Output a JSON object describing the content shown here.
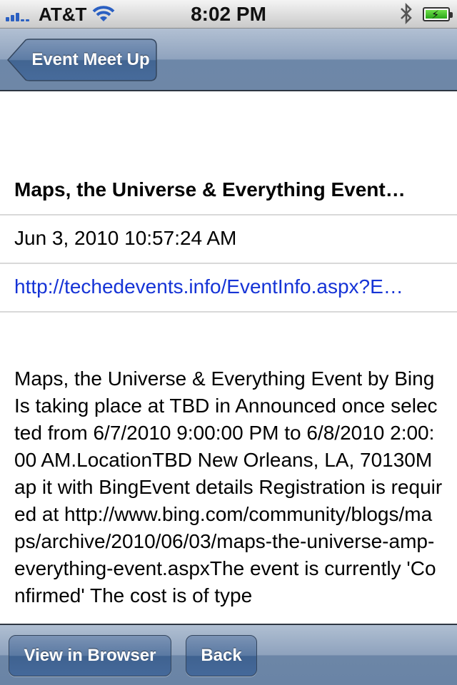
{
  "status_bar": {
    "carrier": "AT&T",
    "time": "8:02 PM",
    "icons": [
      "signal-icon",
      "wifi-icon",
      "bluetooth-icon",
      "battery-charging-icon"
    ]
  },
  "nav": {
    "back_label": "Event Meet Up"
  },
  "detail": {
    "title": "Maps, the Universe & Everything Event…",
    "date": "Jun 3, 2010 10:57:24 AM",
    "url": "http://techedevents.info/EventInfo.aspx?E…",
    "description": "Maps, the Universe & Everything Event by Bing Is taking place at TBD in Announced once selected from 6/7/2010 9:00:00 PM to 6/8/2010 2:00:00 AM.LocationTBD New Orleans, LA, 70130Map it with BingEvent details Registration is required at http://www.bing.com/community/blogs/maps/archive/2010/06/03/maps-the-universe-amp-everything-event.aspxThe event is currently 'Confirmed' The cost is of type"
  },
  "toolbar": {
    "view_in_browser_label": "View in Browser",
    "back_label": "Back"
  },
  "colors": {
    "nav_bar": "#8fa3be",
    "link": "#1533d6",
    "separator": "#d9d9d9"
  }
}
